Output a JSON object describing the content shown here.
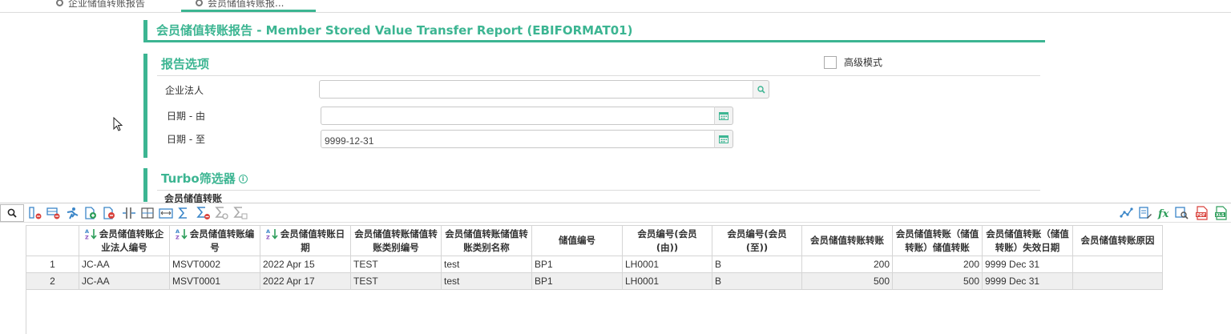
{
  "tabs": [
    {
      "label": "企业储值转账报告"
    },
    {
      "label": "会员储值转账报..."
    }
  ],
  "title": "会员储值转账报告 - Member Stored Value Transfer Report (EBIFORMAT01)",
  "options": {
    "section_title": "报告选项",
    "advanced_mode_label": "高级模式",
    "fields": {
      "legal_entity": {
        "label": "企业法人",
        "value": ""
      },
      "date_from": {
        "label": "日期 - 由",
        "value": ""
      },
      "date_to": {
        "label": "日期 - 至",
        "value": "9999-12-31"
      }
    }
  },
  "turbo": {
    "section_title": "Turbo筛选器",
    "sub_label": "会员储值转账"
  },
  "colors": {
    "accent": "#3cb592"
  },
  "grid": {
    "columns": [
      "会员储值转账企业法人编号",
      "会员储值转账编号",
      "会员储值转账日期",
      "会员储值转账储值转账类别编号",
      "会员储值转账储值转账类别名称",
      "储值编号",
      "会员编号(会员 (由))",
      "会员编号(会员 (至))",
      "会员储值转账转账",
      "会员储值转账（储值转账）储值转账",
      "会员储值转账（储值转账）失效日期",
      "会员储值转账原因"
    ],
    "rows": [
      {
        "idx": "1",
        "entity": "JC-AA",
        "no": "MSVT0002",
        "date": "2022 Apr 15",
        "type_code": "TEST",
        "type_name": "test",
        "sv_no": "BP1",
        "member_from": "LH0001",
        "member_to": "B",
        "amount": "200",
        "sv_amount": "200",
        "expiry": "9999 Dec 31",
        "reason": ""
      },
      {
        "idx": "2",
        "entity": "JC-AA",
        "no": "MSVT0001",
        "date": "2022 Apr 17",
        "type_code": "TEST",
        "type_name": "test",
        "sv_no": "BP1",
        "member_from": "LH0001",
        "member_to": "B",
        "amount": "500",
        "sv_amount": "500",
        "expiry": "9999 Dec 31",
        "reason": ""
      }
    ]
  }
}
